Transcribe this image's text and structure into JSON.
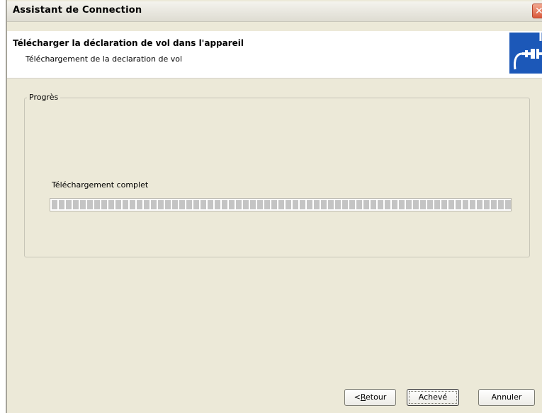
{
  "window": {
    "title": "Assistant de Connection",
    "close_symbol": "✕"
  },
  "header": {
    "title": "Télécharger  la déclaration de vol dans l'appareil",
    "subtitle": "Téléchargement de la declaration de vol",
    "icon": "connection-plug-icon"
  },
  "progress_group": {
    "legend": "Progrès",
    "status_text": "Téléchargement complet",
    "progress_fraction": 1.0
  },
  "buttons": {
    "back_prefix": "<",
    "back_mnemonic": "R",
    "back_rest": "etour",
    "finish": "Achevé",
    "cancel": "Annuler"
  },
  "colors": {
    "window_bg": "#ece9d8",
    "icon_bg": "#1c58b8",
    "progress_block": "#c4c4c4"
  }
}
